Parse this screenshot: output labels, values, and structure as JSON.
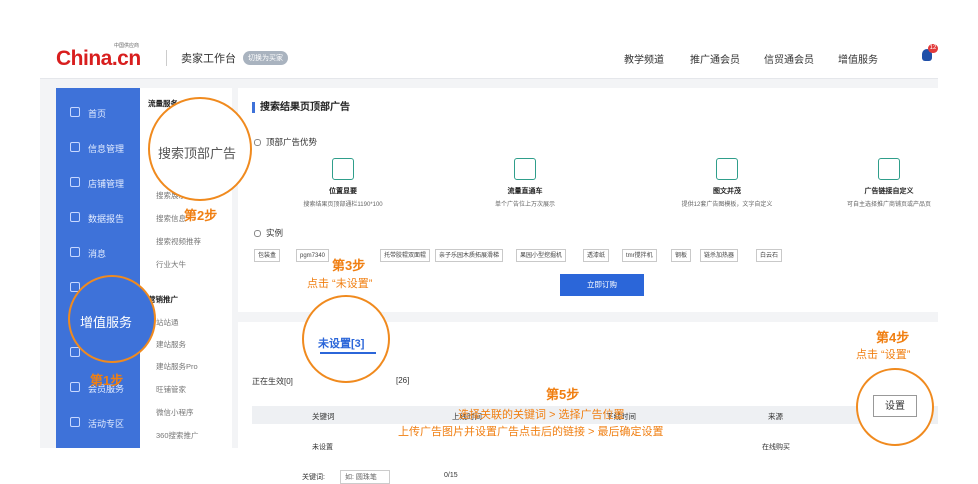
{
  "topbar": {
    "logo": "China.cn",
    "logo_sub": "中国供应商",
    "workbench": "卖家工作台",
    "switch": "切换为买家",
    "nav": [
      "教学频道",
      "推广通会员",
      "信贸通会员",
      "增值服务"
    ],
    "badge": "12"
  },
  "sidebar": {
    "items": [
      "首页",
      "信息管理",
      "店铺管理",
      "数据报告",
      "消息",
      "增值服务",
      "",
      "会员服务",
      "活动专区"
    ]
  },
  "subnav": {
    "group1": "流量服务",
    "items1": [
      "搜索顶部广告",
      "搜索展示",
      "搜索信息",
      "搜索视频推荐",
      "行业大牛"
    ],
    "group2": "营销推广",
    "items2": [
      "站站通",
      "建站服务",
      "建站服务Pro",
      "旺铺管家",
      "微信小程序",
      "360搜索推广"
    ]
  },
  "main": {
    "title": "搜索结果页顶部广告",
    "advantage": "顶部广告优势",
    "features": [
      {
        "title": "位置显要",
        "desc": "搜索结果页顶部通栏1190*100"
      },
      {
        "title": "流量直通车",
        "desc": "单个广告位上万次展示"
      },
      {
        "title": "图文并茂",
        "desc": "提供12套广告图模板，文字自定义"
      },
      {
        "title": "广告链接自定义",
        "desc": "可自主选择推广商铺页或产品页"
      }
    ],
    "example": "实例",
    "tags": [
      "包装盒",
      "pgm7340",
      "托带胶辊双面辊",
      "亲子乐园木质拓展滑梯",
      "果园小型挖掘机",
      "透漆纸",
      "tmr搅拌机",
      "钢板",
      "链杀加热器",
      "白云石"
    ],
    "buy": "立即订购"
  },
  "table": {
    "tabs": [
      "正在生效[0]",
      "未设置[3]",
      "[26]"
    ],
    "headers": [
      "关键词",
      "上线时间",
      "下线时间",
      "来源",
      "操作"
    ],
    "row": {
      "keyword": "未设置",
      "online": "未设置",
      "source": "在线购买",
      "action": "设置"
    },
    "keyword_label": "关键词:",
    "keyword_placeholder": "如: 圆珠笔",
    "count": "0/15"
  },
  "annotations": {
    "circle1": "搜索顶部广告",
    "circle2": "增值服务",
    "circle3": "未设置[3]",
    "circle4": "设置",
    "step1": "第1步",
    "step2": "第2步",
    "step3": "第3步",
    "step3_sub": "点击 “未设置”",
    "step4": "第4步",
    "step4_sub": "点击 “设置”",
    "step5": "第5步",
    "step5_line1": "选择关联的关键词 > 选择广告位置",
    "step5_line2": "上传广告图片并设置广告点击后的链接 > 最后确定设置"
  }
}
